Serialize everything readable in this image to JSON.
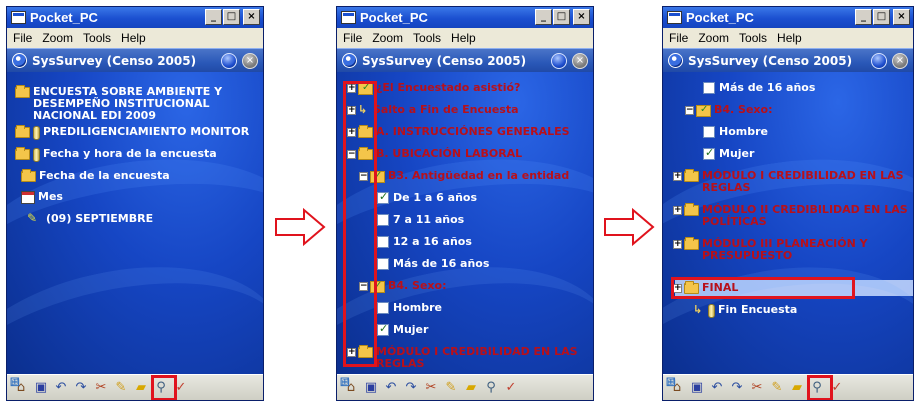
{
  "window_title": "Pocket_PC",
  "window_buttons": [
    "_",
    "□",
    "×"
  ],
  "menu": [
    "File",
    "Zoom",
    "Tools",
    "Help"
  ],
  "app_title": "SysSurvey (Censo 2005)",
  "screen1": {
    "tree": [
      {
        "icon": "folder-icon",
        "text": "ENCUESTA SOBRE AMBIENTE Y\nDESEMPEÑO INSTITUCIONAL\nNACIONAL EDI 2009"
      },
      {
        "icon": "cylinder-icon",
        "text": "PREDILIGENCIAMIENTO MONITOR"
      },
      {
        "icon": "cylinder-icon",
        "text": "Fecha y hora de la encuesta"
      },
      {
        "icon": "folder-icon",
        "text": "Fecha de la encuesta"
      },
      {
        "icon": "calendar-icon",
        "text": "Mes"
      },
      {
        "icon": "pencil-icon",
        "text": "(09) SEPTIEMBRE"
      }
    ]
  },
  "screen2": {
    "tree": [
      {
        "expander": "+",
        "icon": "checked-folder-icon",
        "text": "¿El Encuestado asistió?"
      },
      {
        "expander": "+",
        "icon": "jump-icon",
        "text": "Salto a Fin de Encuesta"
      },
      {
        "expander": "+",
        "icon": "folder-icon",
        "text": "A. INSTRUCCIÓNES GENERALES"
      },
      {
        "expander": "-",
        "icon": "folder-icon",
        "text": "B. UBICACIÓN LABORAL"
      },
      {
        "expander": "-",
        "icon": "checked-folder-icon",
        "text": "B3. Antigüedad en la entidad"
      },
      {
        "check": true,
        "text": "De 1 a 6 años"
      },
      {
        "check": false,
        "text": "7 a 11 años"
      },
      {
        "check": false,
        "text": "12 a 16 años"
      },
      {
        "check": false,
        "text": "Más de 16 años"
      },
      {
        "expander": "-",
        "icon": "checked-folder-icon",
        "text": "B4. Sexo:"
      },
      {
        "check": false,
        "text": "Hombre"
      },
      {
        "check": true,
        "text": "Mujer"
      },
      {
        "expander": "+",
        "icon": "folder-icon",
        "text": "MÓDULO I CREDIBILIDAD EN LAS\nREGLAS"
      }
    ]
  },
  "screen3": {
    "tree": [
      {
        "check": false,
        "text": "Más de 16 años"
      },
      {
        "expander": "-",
        "icon": "checked-folder-icon",
        "text": "B4. Sexo:"
      },
      {
        "check": false,
        "text": "Hombre"
      },
      {
        "check": true,
        "text": "Mujer"
      },
      {
        "expander": "+",
        "icon": "folder-icon",
        "text": "MÓDULO I CREDIBILIDAD EN LAS\nREGLAS"
      },
      {
        "expander": "+",
        "icon": "folder-icon",
        "text": "MÓDULO II CREDIBILIDAD EN LAS\nPOLÍTICAS"
      },
      {
        "expander": "+",
        "icon": "folder-icon",
        "text": "MÓDULO III PLANEACIÓN Y\nPRESUPUESTO"
      },
      {
        "expander": "+",
        "icon": "folder-icon",
        "text": "FINAL"
      },
      {
        "icon": "cylinder-icon",
        "text": "Fin Encuesta"
      }
    ]
  },
  "toolbar_icons": [
    "home-icon",
    "save-icon",
    "undo-icon",
    "redo-icon",
    "tree-icon",
    "cut-icon",
    "structure-icon",
    "pencil-icon",
    "open-folder-icon",
    "search-icon",
    "check-icon"
  ],
  "colors": {
    "highlight": "#e0131d",
    "tree_red": "#b8101a",
    "tree_white": "#ffffff",
    "background": "#0b2f8e"
  }
}
